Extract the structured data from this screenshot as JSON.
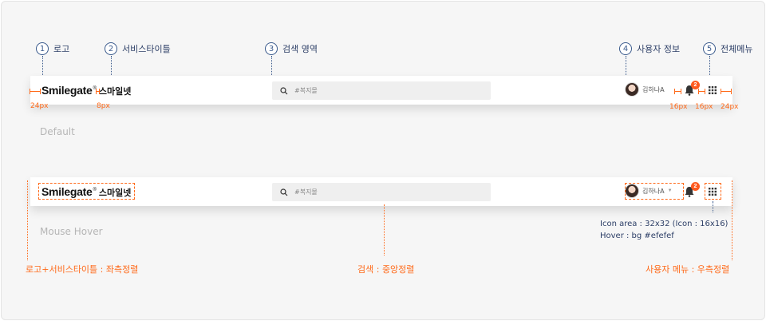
{
  "callouts": [
    {
      "num": "1",
      "label": "로고"
    },
    {
      "num": "2",
      "label": "서비스타이틀"
    },
    {
      "num": "3",
      "label": "검색 영역"
    },
    {
      "num": "4",
      "label": "사용자 정보"
    },
    {
      "num": "5",
      "label": "전체메뉴"
    }
  ],
  "header": {
    "brand": "Smilegate",
    "reg_mark": "®",
    "service_title": "스마일넷",
    "search_placeholder": "#복지몰",
    "user_name": "김하나A",
    "notification_count": "2"
  },
  "states": {
    "default": "Default",
    "hover": "Mouse Hover"
  },
  "measurements": {
    "left_padding": "24px",
    "logo_gap": "8px",
    "icon_gap_1": "16px",
    "icon_gap_2": "16px",
    "right_padding": "24px"
  },
  "notes": {
    "icon_area": "Icon area : 32x32 (Icon : 16x16)",
    "hover_bg": "Hover : bg #efefef"
  },
  "alignment": {
    "left": "로고+서비스타이틀 : 좌측정렬",
    "center": "검색 : 중앙정렬",
    "right": "사용자 메뉴 : 우측정렬"
  },
  "colors": {
    "accent_orange": "#ff6a1a",
    "badge": "#ff5a1f",
    "callout_navy": "#3a5a8c",
    "search_bg": "#efefef"
  }
}
